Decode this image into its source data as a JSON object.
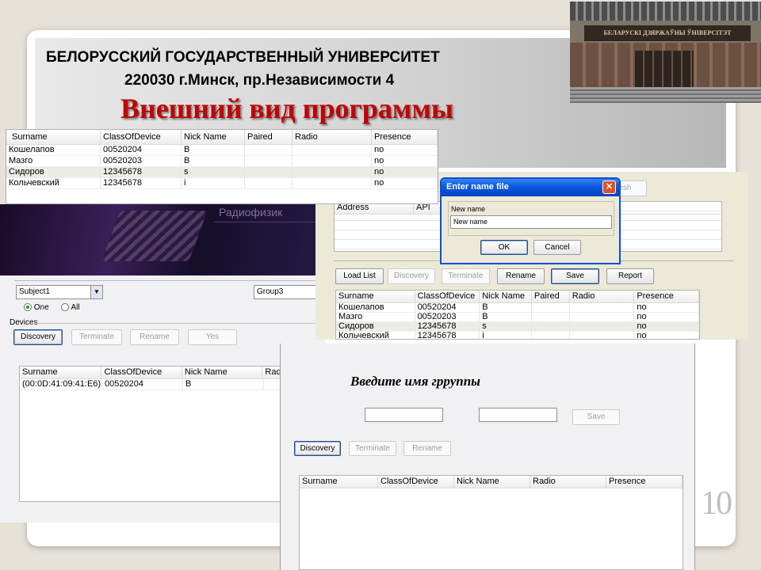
{
  "slide": {
    "university": "БЕЛОРУССКИЙ ГОСУДАРСТВЕННЫЙ УНИВЕРСИТЕТ",
    "address": "220030 г.Минск, пр.Независимости 4",
    "title": "Внешний вид программы",
    "page_number": "10",
    "building_sign": "БЕЛАРУСКІ ДЗЯРЖАЎНЫ ЎНІВЕРСІТЭТ"
  },
  "columns": {
    "surname": "Surname",
    "class": "ClassOfDevice",
    "nick": "Nick Name",
    "paired": "Paired",
    "radio": "Radio",
    "presence": "Presence",
    "address": "Address",
    "api": "API"
  },
  "devices": [
    {
      "surname": "Кошелапов",
      "class": "00520204",
      "nick": "B",
      "presence": "no"
    },
    {
      "surname": "Мазго",
      "class": "00520203",
      "nick": "B",
      "presence": "no"
    },
    {
      "surname": "Сидоров",
      "class": "12345678",
      "nick": "s",
      "presence": "no"
    },
    {
      "surname": "Кольчевский",
      "class": "12345678",
      "nick": "i",
      "presence": "no"
    }
  ],
  "window_left": {
    "banner_text": "Радиофизик",
    "subject_value": "Subject1",
    "group_value": "Group3",
    "radio_one": "One",
    "radio_all": "All",
    "devices_label": "Devices",
    "buttons": {
      "discovery": "Discovery",
      "terminate": "Terminate",
      "rename": "Rename",
      "yes": "Yes"
    },
    "row": {
      "surname": "(00:0D:41:09:41:E6)",
      "class": "00520204",
      "nick": "B"
    },
    "radio_col_fragment": "Radi"
  },
  "window_right": {
    "refresh_fragment": "resh",
    "buttons": {
      "load_list": "Load List",
      "discovery": "Discovery",
      "terminate": "Terminate",
      "rename": "Rename",
      "save": "Save",
      "report": "Report"
    }
  },
  "dialog": {
    "title": "Enter name file",
    "label": "New name",
    "value": "New name",
    "ok": "OK",
    "cancel": "Cancel"
  },
  "window_bottom": {
    "prompt": "Введите имя грруппы",
    "save": "Save",
    "buttons": {
      "discovery": "Discovery",
      "terminate": "Terminate",
      "rename": "Rename"
    }
  },
  "colors": {
    "title_red": "#c00000",
    "xp_blue": "#0a4fd6",
    "close_red": "#d9532c"
  }
}
